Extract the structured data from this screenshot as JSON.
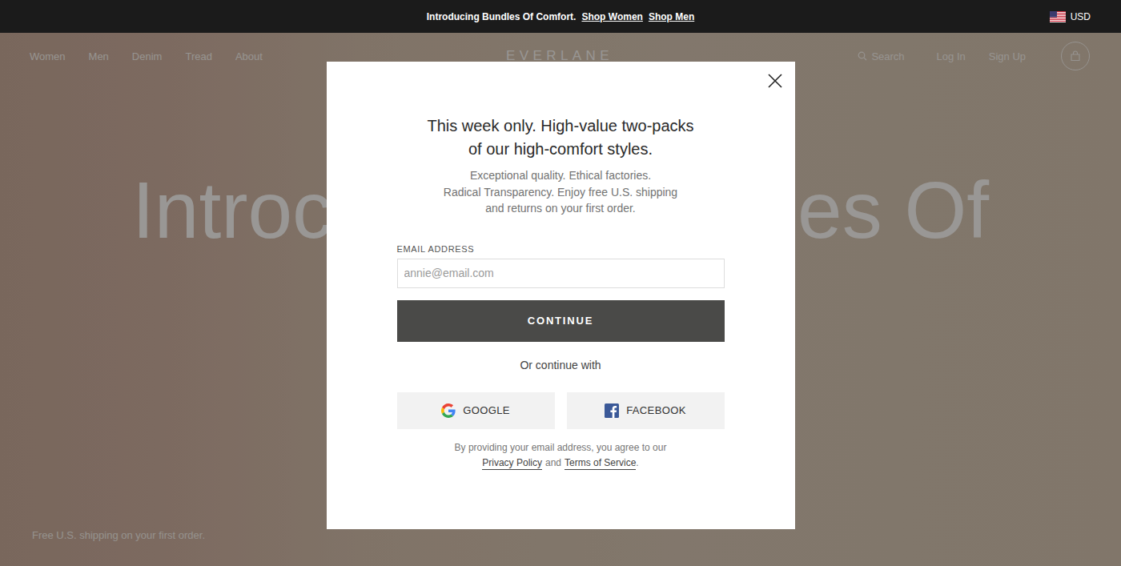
{
  "announcement": {
    "text": "Introducing Bundles Of Comfort.",
    "links": [
      "Shop Women",
      "Shop Men"
    ],
    "currency": "USD"
  },
  "nav": {
    "left": [
      "Women",
      "Men",
      "Denim",
      "Tread",
      "About"
    ],
    "logo": "EVERLANE",
    "search": "Search",
    "right": [
      "Log In",
      "Sign Up"
    ]
  },
  "hero": {
    "headline_fragments": [
      "Introc",
      "es Of"
    ],
    "note": "Free U.S. shipping on your first order."
  },
  "modal": {
    "title_lines": [
      "This week only. High-value two-packs",
      "of our high-comfort styles."
    ],
    "subtitle_lines": [
      "Exceptional quality. Ethical factories.",
      "Radical Transparency. Enjoy free U.S. shipping",
      "and returns on your first order."
    ],
    "email": {
      "label": "EMAIL ADDRESS",
      "placeholder": "annie@email.com"
    },
    "submit": "CONTINUE",
    "alt_label": "Or continue with",
    "social": [
      {
        "label": "GOOGLE",
        "kind": "google"
      },
      {
        "label": "FACEBOOK",
        "kind": "facebook"
      }
    ],
    "legal": {
      "text": "By providing your email address, you agree to our",
      "links": [
        "Privacy Policy",
        "Terms of Service"
      ],
      "joiner": "and",
      "end": "."
    }
  }
}
